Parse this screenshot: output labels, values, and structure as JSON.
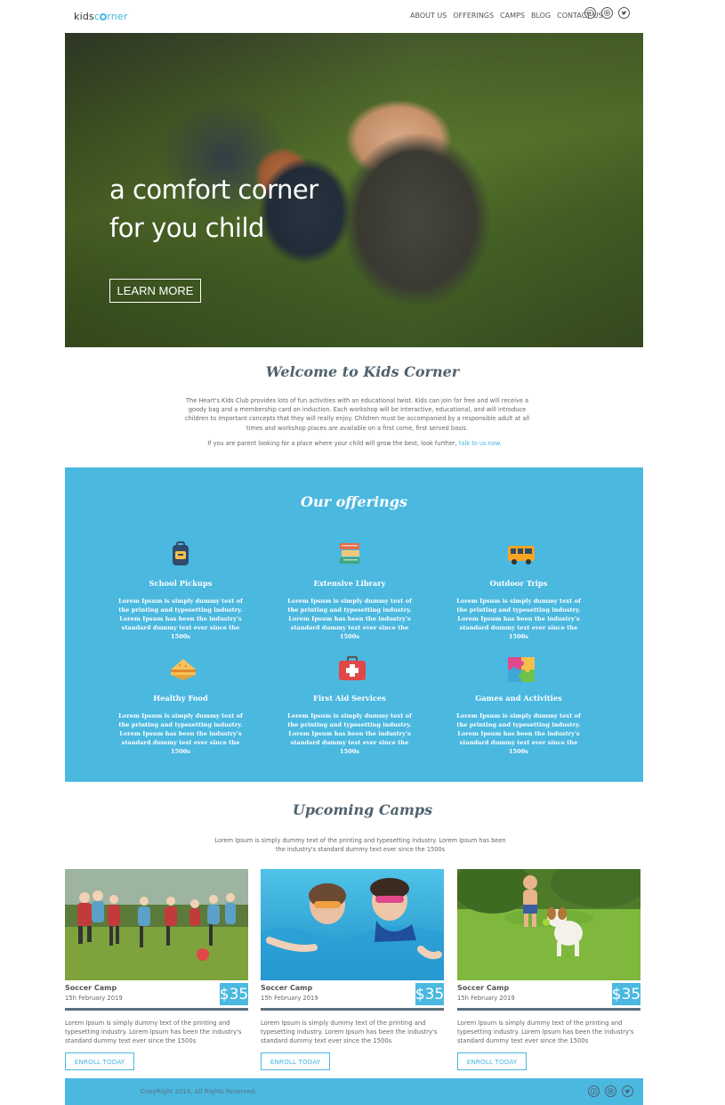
{
  "header": {
    "logo_prefix": "kids",
    "logo_o": "o",
    "logo_suffix": "rner",
    "nav": [
      "ABOUT US",
      "OFFERINGS",
      "CAMPS",
      "BLOG",
      "CONTACT US"
    ],
    "social_icons": [
      "facebook-icon",
      "instagram-icon",
      "twitter-icon"
    ]
  },
  "hero": {
    "title_line1": "a comfort corner",
    "title_line2": "for you child",
    "button": "LEARN MORE"
  },
  "welcome": {
    "title": "Welcome to Kids Corner",
    "paragraph": "The Heart's Kids Club provides lots of fun activities with an educational twist. Kids can join for free and will receive a goody bag and a membership card on induction. Each workshop will be interactive, educational, and will introduce children to important concepts that they will really enjoy. Children must be accompanied by a responsible adult at all times and workshop places are available on a first come, first served basis.",
    "cta_text": "If you are parent looking for a place where your child will grow the best, look further,",
    "cta_link": "talk to us now."
  },
  "offerings": {
    "title": "Our offerings",
    "items": [
      {
        "title": "School Pickups",
        "icon": "backpack-icon",
        "desc": "Lorem Ipsum is simply dummy text of the printing and typesetting industry. Lorem Ipsum has been the industry's standard dummy text ever since the 1500s"
      },
      {
        "title": "Extensive Library",
        "icon": "books-icon",
        "desc": "Lorem Ipsum is simply dummy text of the printing and typesetting industry. Lorem Ipsum has been the industry's standard dummy text ever since the 1500s"
      },
      {
        "title": "Outdoor Trips",
        "icon": "bus-icon",
        "desc": "Lorem Ipsum is simply dummy text of the printing and typesetting industry. Lorem Ipsum has been the industry's standard dummy text ever since the 1500s"
      },
      {
        "title": "Healthy Food",
        "icon": "sandwich-icon",
        "desc": "Lorem Ipsum is simply dummy text of the printing and typesetting industry. Lorem Ipsum has been the industry's standard dummy text ever since the 1500s"
      },
      {
        "title": "First Aid Services",
        "icon": "first-aid-kit-icon",
        "desc": "Lorem Ipsum is simply dummy text of the printing and typesetting industry. Lorem Ipsum has been the industry's standard dummy text ever since the 1500s"
      },
      {
        "title": "Games and Activities",
        "icon": "puzzle-icon",
        "desc": "Lorem Ipsum is simply dummy text of the printing and typesetting industry. Lorem Ipsum has been the industry's standard dummy text ever since the 1500s"
      }
    ]
  },
  "camps": {
    "title": "Upcoming Camps",
    "intro": "Lorem Ipsum is simply dummy text of the printing and typesetting industry. Lorem Ipsum has been the industry's standard dummy text ever since the 1500s",
    "items": [
      {
        "name": "Soccer Camp",
        "date": "15h February 2019",
        "price": "$35",
        "desc": "Lorem Ipsum is simply dummy text of the printing and typesetting industry. Lorem Ipsum has been the industry's standard dummy text ever since the 1500s",
        "button": "ENROLL TODAY",
        "image": "kids-playing-soccer-photo"
      },
      {
        "name": "Soccer Camp",
        "date": "15h February 2019",
        "price": "$35",
        "desc": "Lorem Ipsum is simply dummy text of the printing and typesetting industry. Lorem Ipsum has been the industry's standard dummy text ever since the 1500s",
        "button": "ENROLL TODAY",
        "image": "kids-swimming-photo"
      },
      {
        "name": "Soccer Camp",
        "date": "15h February 2019",
        "price": "$35",
        "desc": "Lorem Ipsum is simply dummy text of the printing and typesetting industry. Lorem Ipsum has been the industry's standard dummy text ever since the 1500s",
        "button": "ENROLL TODAY",
        "image": "boy-with-dog-photo"
      }
    ]
  },
  "footer": {
    "copyright": "CopyRight 2014. All Rights Reserved."
  },
  "colors": {
    "accent": "#4bb8e0",
    "heading": "#4f6270",
    "divider": "#5b6f7d"
  }
}
